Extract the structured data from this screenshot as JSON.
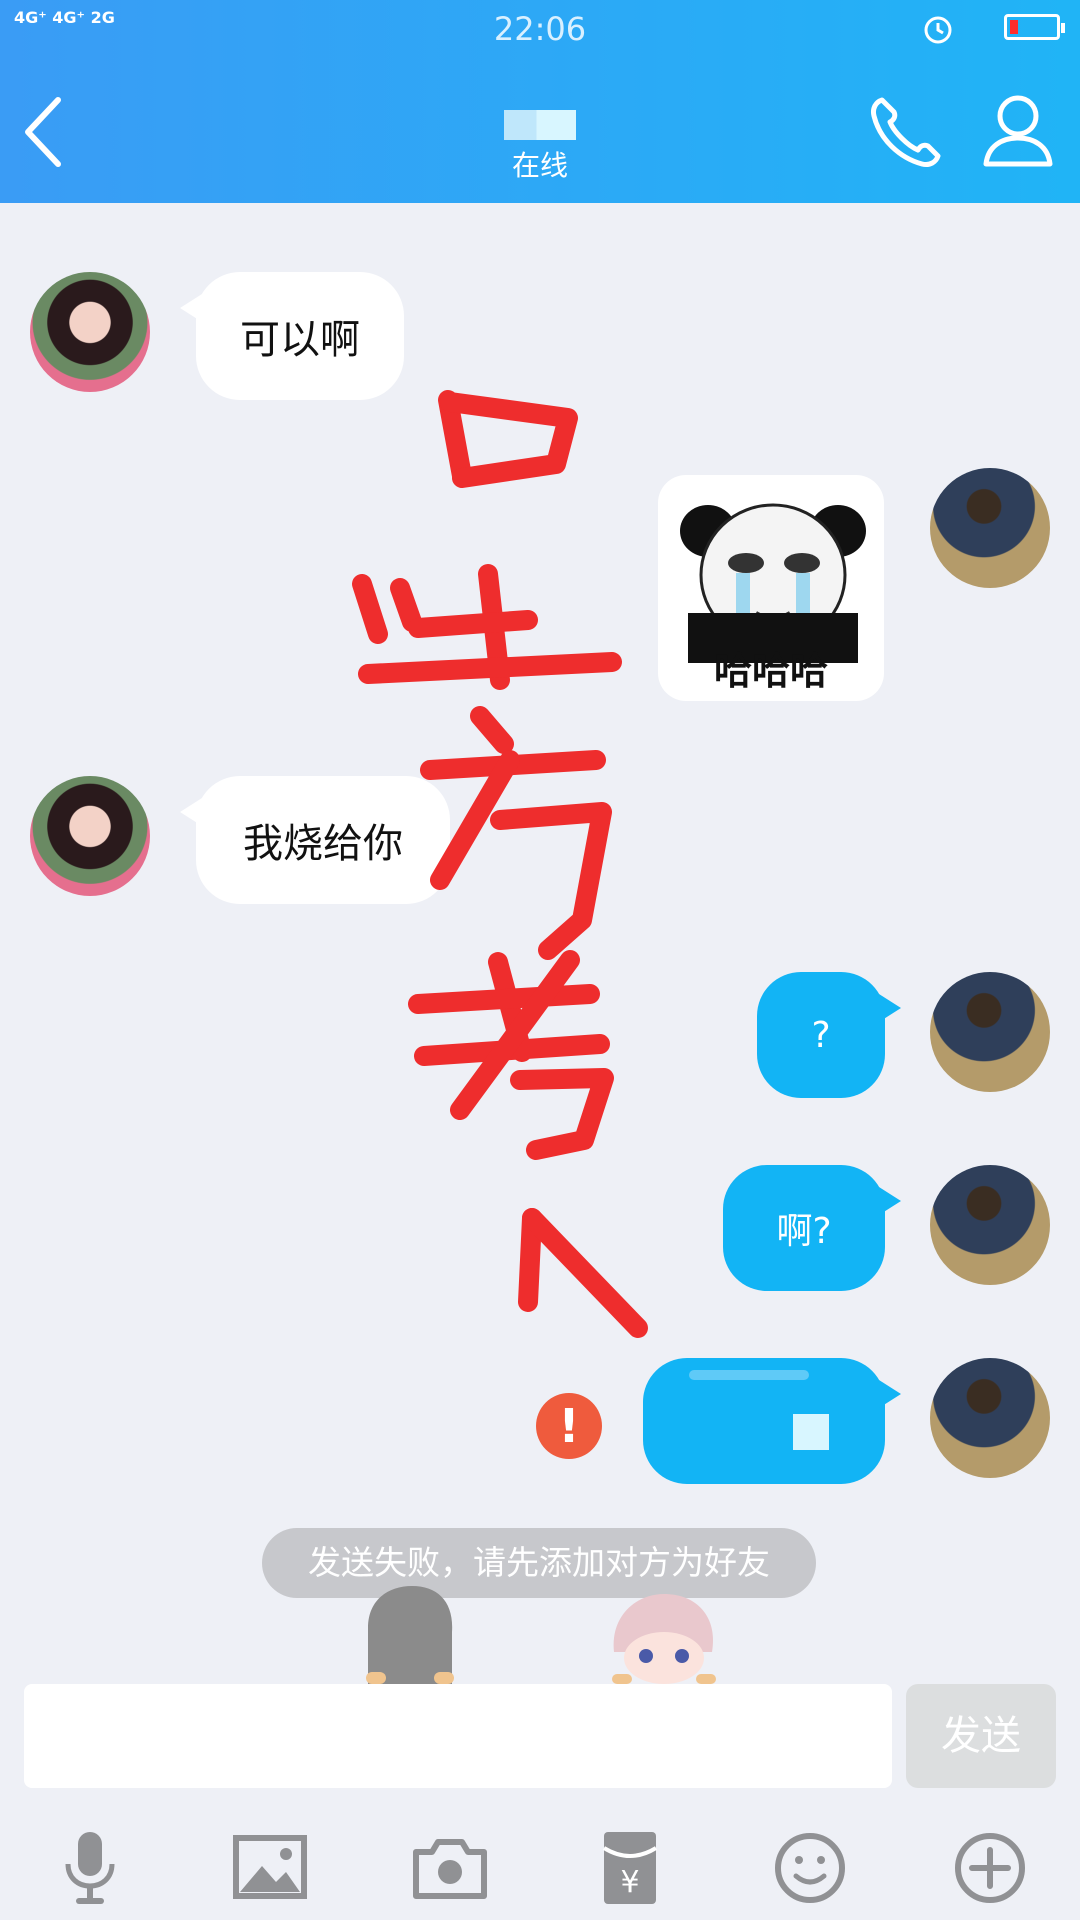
{
  "status_bar": {
    "network": "4G⁺ 4G⁺ 2G",
    "time": "22:06"
  },
  "header": {
    "contact_status": "在线"
  },
  "messages": [
    {
      "side": "left",
      "text": "可以啊"
    },
    {
      "side": "right",
      "type": "sticker",
      "caption": "哈哈哈"
    },
    {
      "side": "left",
      "text": "我烧给你"
    },
    {
      "side": "right",
      "text": "?"
    },
    {
      "side": "right",
      "text": "啊?"
    },
    {
      "side": "right",
      "text": "",
      "failed": true
    }
  ],
  "error_badge": "!",
  "notice": "发送失败，请先添加对方为好友",
  "composer": {
    "input_value": "",
    "send_label": "发送"
  },
  "toolbar": {
    "icons": [
      "microphone-icon",
      "image-icon",
      "camera-icon",
      "red-packet-icon",
      "emoji-icon",
      "plus-icon"
    ]
  },
  "colors": {
    "header_start": "#3a9cf5",
    "header_end": "#20b4f6",
    "sent_bubble": "#12b4f5",
    "received_bubble": "#ffffff",
    "error": "#ef5b3d",
    "scribble": "#ee2d2d"
  }
}
